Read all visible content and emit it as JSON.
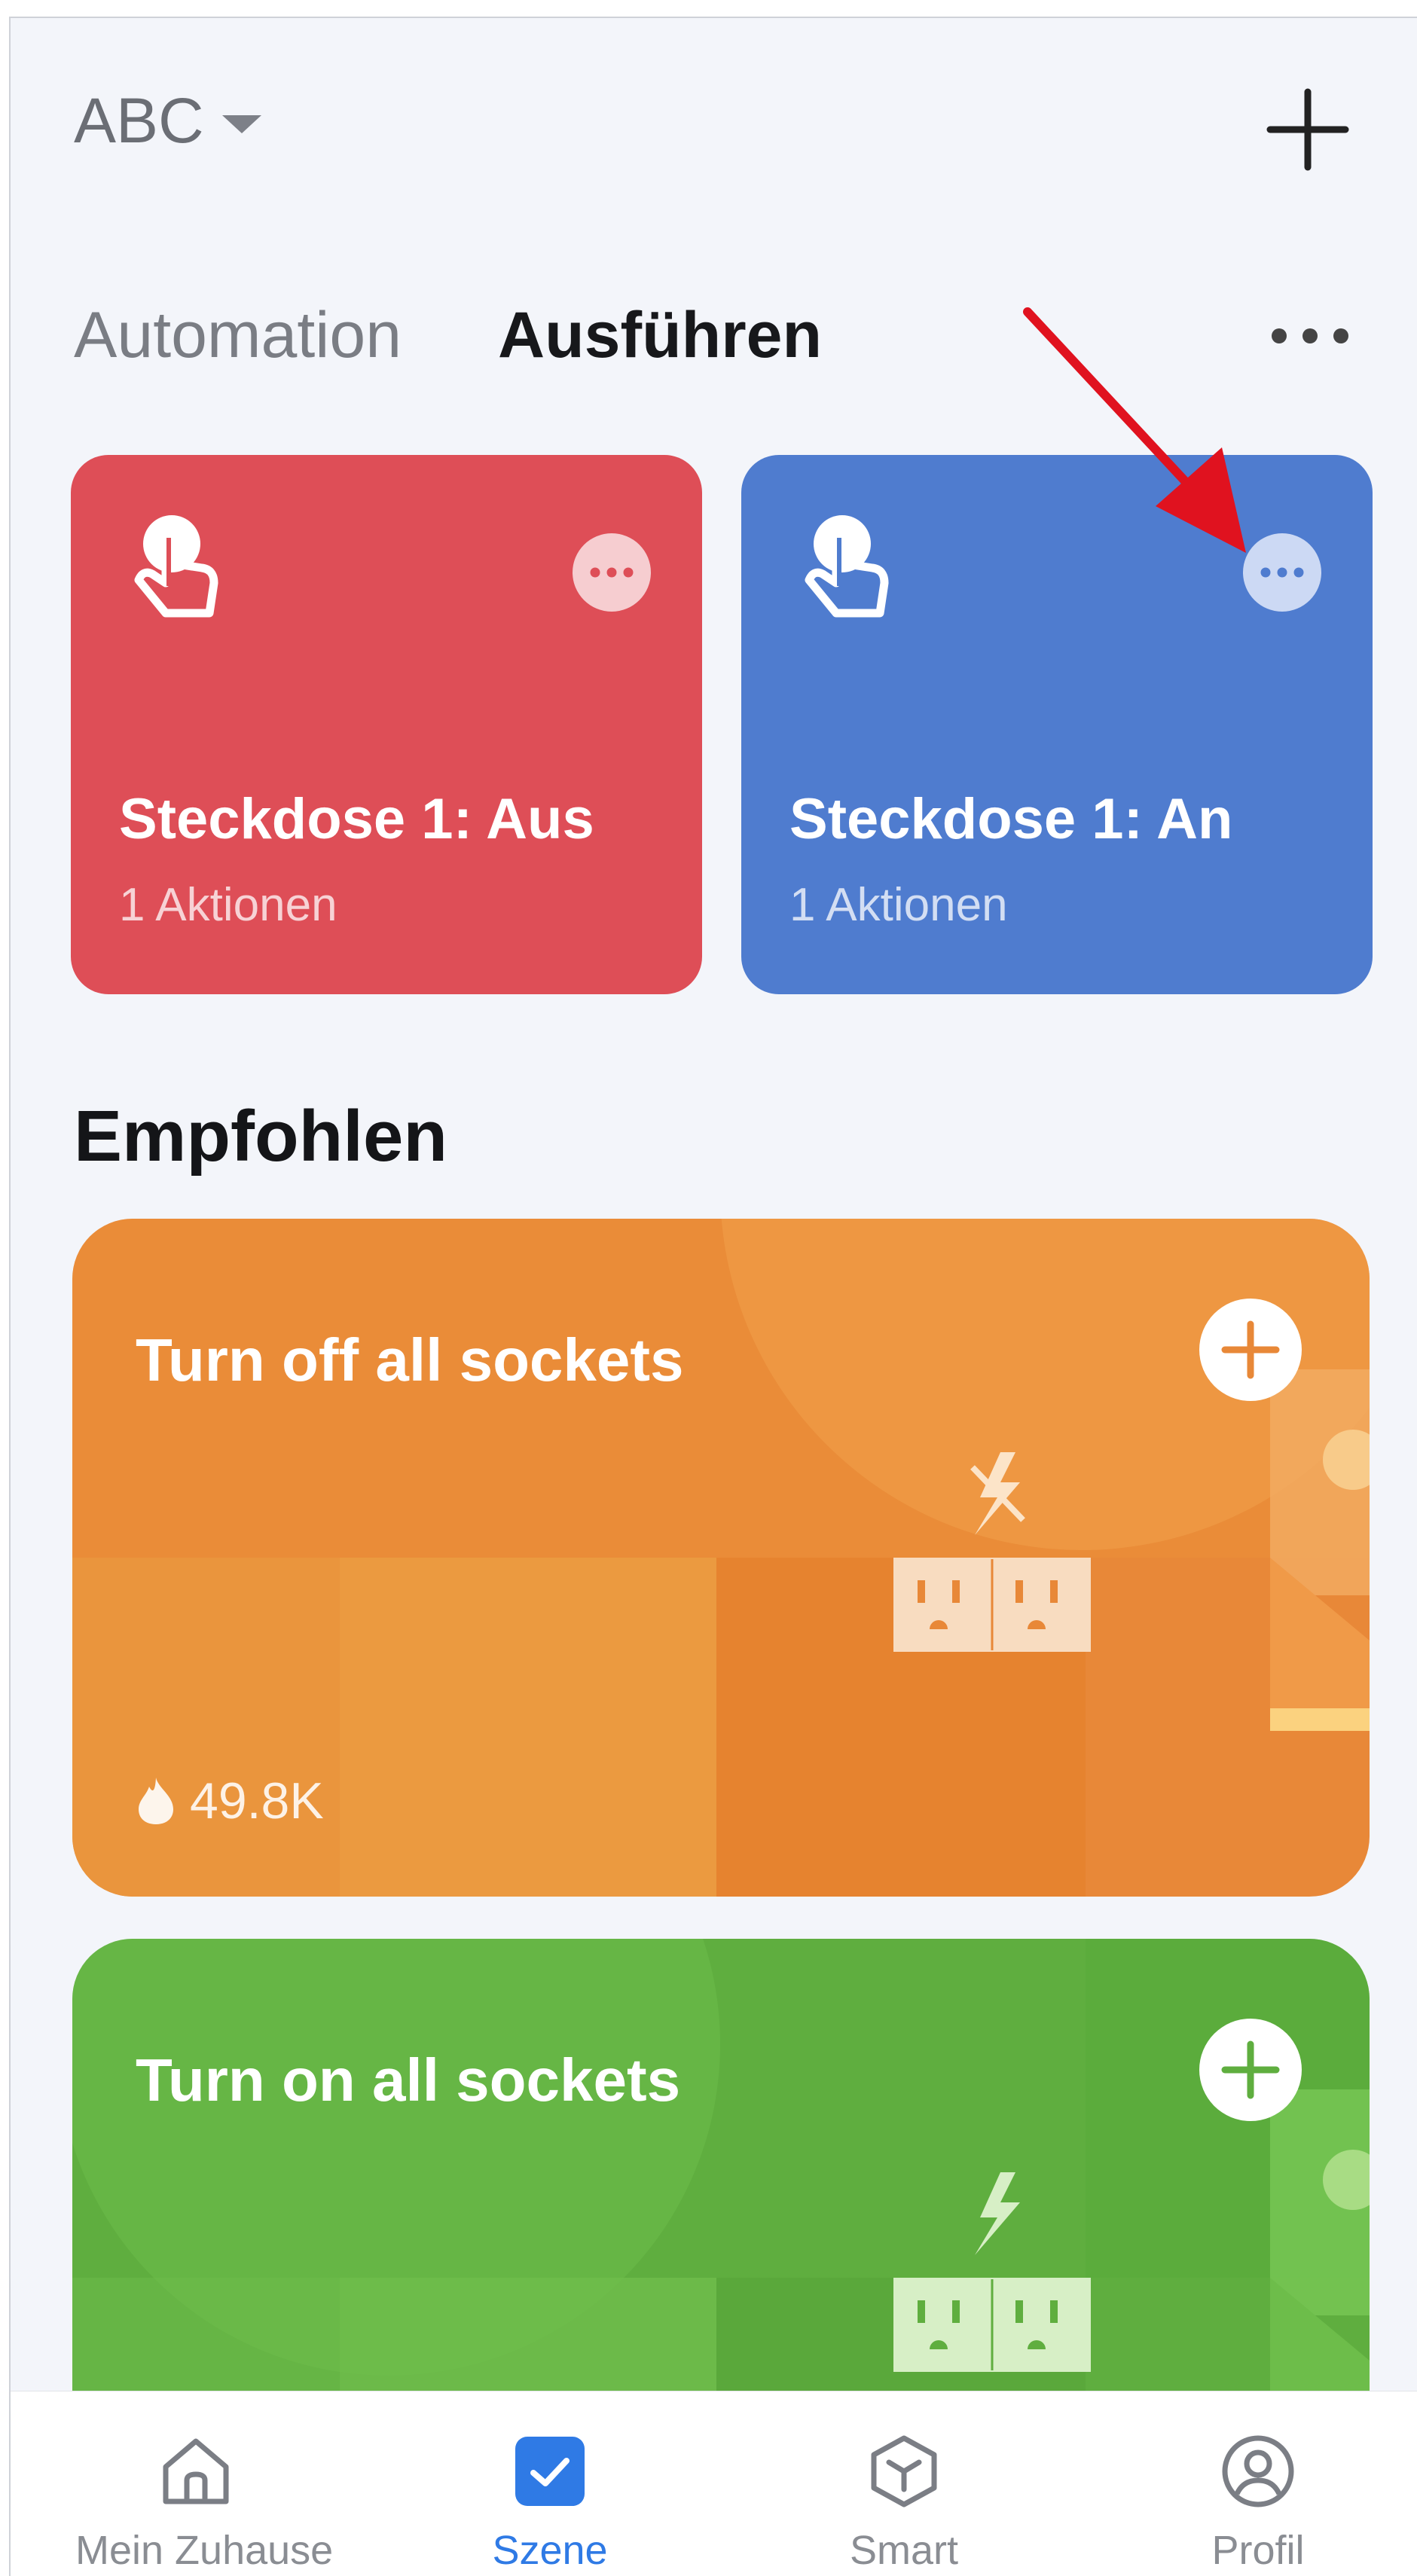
{
  "header": {
    "home_name": "ABC"
  },
  "tabs": [
    {
      "label": "Automation",
      "active": false
    },
    {
      "label": "Ausführen",
      "active": true
    }
  ],
  "scenes": [
    {
      "title": "Steckdose 1: Aus",
      "subtitle": "1 Aktionen",
      "color": "#de4e57"
    },
    {
      "title": "Steckdose 1: An",
      "subtitle": "1 Aktionen",
      "color": "#4f7ccf"
    }
  ],
  "recommended": {
    "section_title": "Empfohlen",
    "items": [
      {
        "title": "Turn off all sockets",
        "count": "49.8K",
        "color": "#e88838",
        "icon": "socket-off-icon"
      },
      {
        "title": "Turn on all sockets",
        "color": "#5fae3f",
        "icon": "socket-on-icon"
      }
    ]
  },
  "bottom_nav": [
    {
      "label": "Mein Zuhause",
      "icon": "home-icon",
      "active": false
    },
    {
      "label": "Szene",
      "icon": "checkbox-icon",
      "active": true
    },
    {
      "label": "Smart",
      "icon": "cube-icon",
      "active": false
    },
    {
      "label": "Profil",
      "icon": "profile-icon",
      "active": false
    }
  ],
  "colors": {
    "accent": "#2f7ae5",
    "annotation_arrow": "#e0121f"
  }
}
